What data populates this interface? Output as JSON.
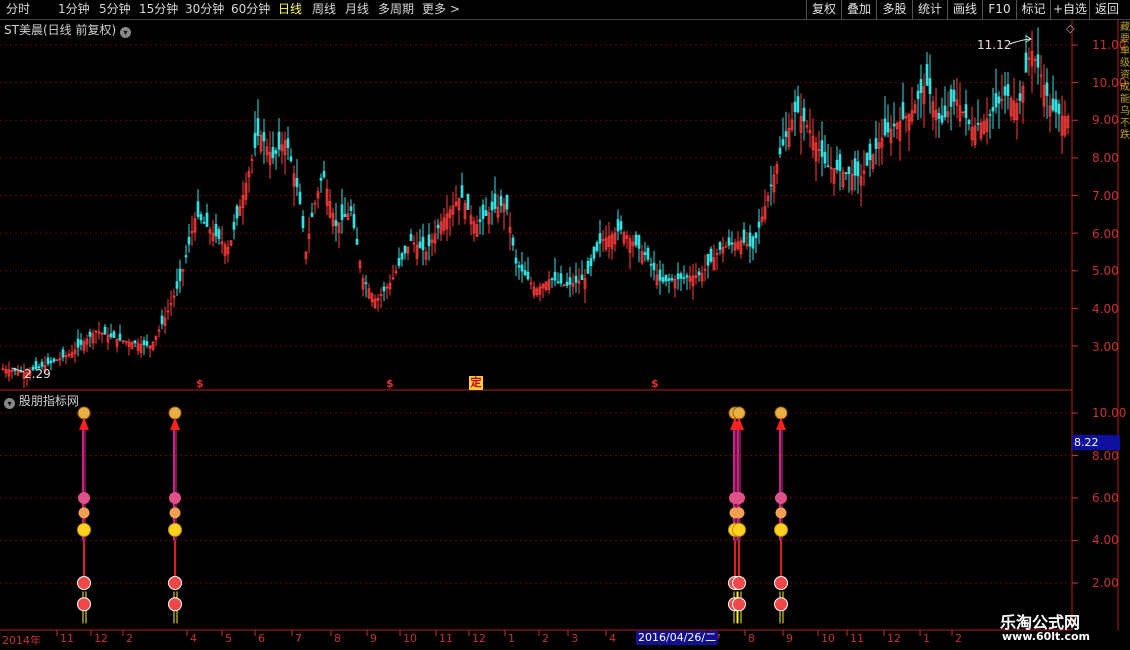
{
  "toolbar": {
    "periods": [
      "分时",
      "1分钟",
      "5分钟",
      "15分钟",
      "30分钟",
      "60分钟",
      "日线",
      "周线",
      "月线",
      "多周期",
      "更多 >"
    ],
    "active_index": 6,
    "right_buttons": [
      "复权",
      "叠加",
      "多股",
      "统计",
      "画线",
      "F10",
      "标记",
      "+自选",
      "返回"
    ]
  },
  "chart": {
    "stock_title": "ST美晨(日线 前复权)",
    "high_label": "11.12",
    "low_label": "2.29",
    "price_axis": [
      "11.00",
      "10.00",
      "9.00",
      "8.00",
      "7.00",
      "6.00",
      "5.00",
      "4.00",
      "3.00"
    ],
    "signal_labels": [
      "$",
      "$",
      "定",
      "$"
    ]
  },
  "indicator": {
    "title": "股朋指标网",
    "axis": [
      "10.00",
      "8.00",
      "6.00",
      "4.00",
      "2.00"
    ],
    "current_value": "8.22"
  },
  "time_axis": [
    "2014年",
    "11",
    "12",
    "2",
    "4",
    "5",
    "6",
    "7",
    "8",
    "9",
    "10",
    "11",
    "12",
    "1",
    "2",
    "3",
    "4",
    "7",
    "8",
    "9",
    "10",
    "11",
    "12",
    "1",
    "2"
  ],
  "cursor_date": "2016/04/26/二",
  "watermark": {
    "name": "乐淘公式网",
    "url": "www.60lt.com"
  },
  "right_strip_chars": "藏\n要\n单\n级\n资\n成\n能\n乌\n不\n跌",
  "colors": {
    "up": "#ff3c3c",
    "down": "#33e0e0",
    "grid": "#6a0000",
    "axis": "#c83232",
    "active": "#ffff55"
  }
}
